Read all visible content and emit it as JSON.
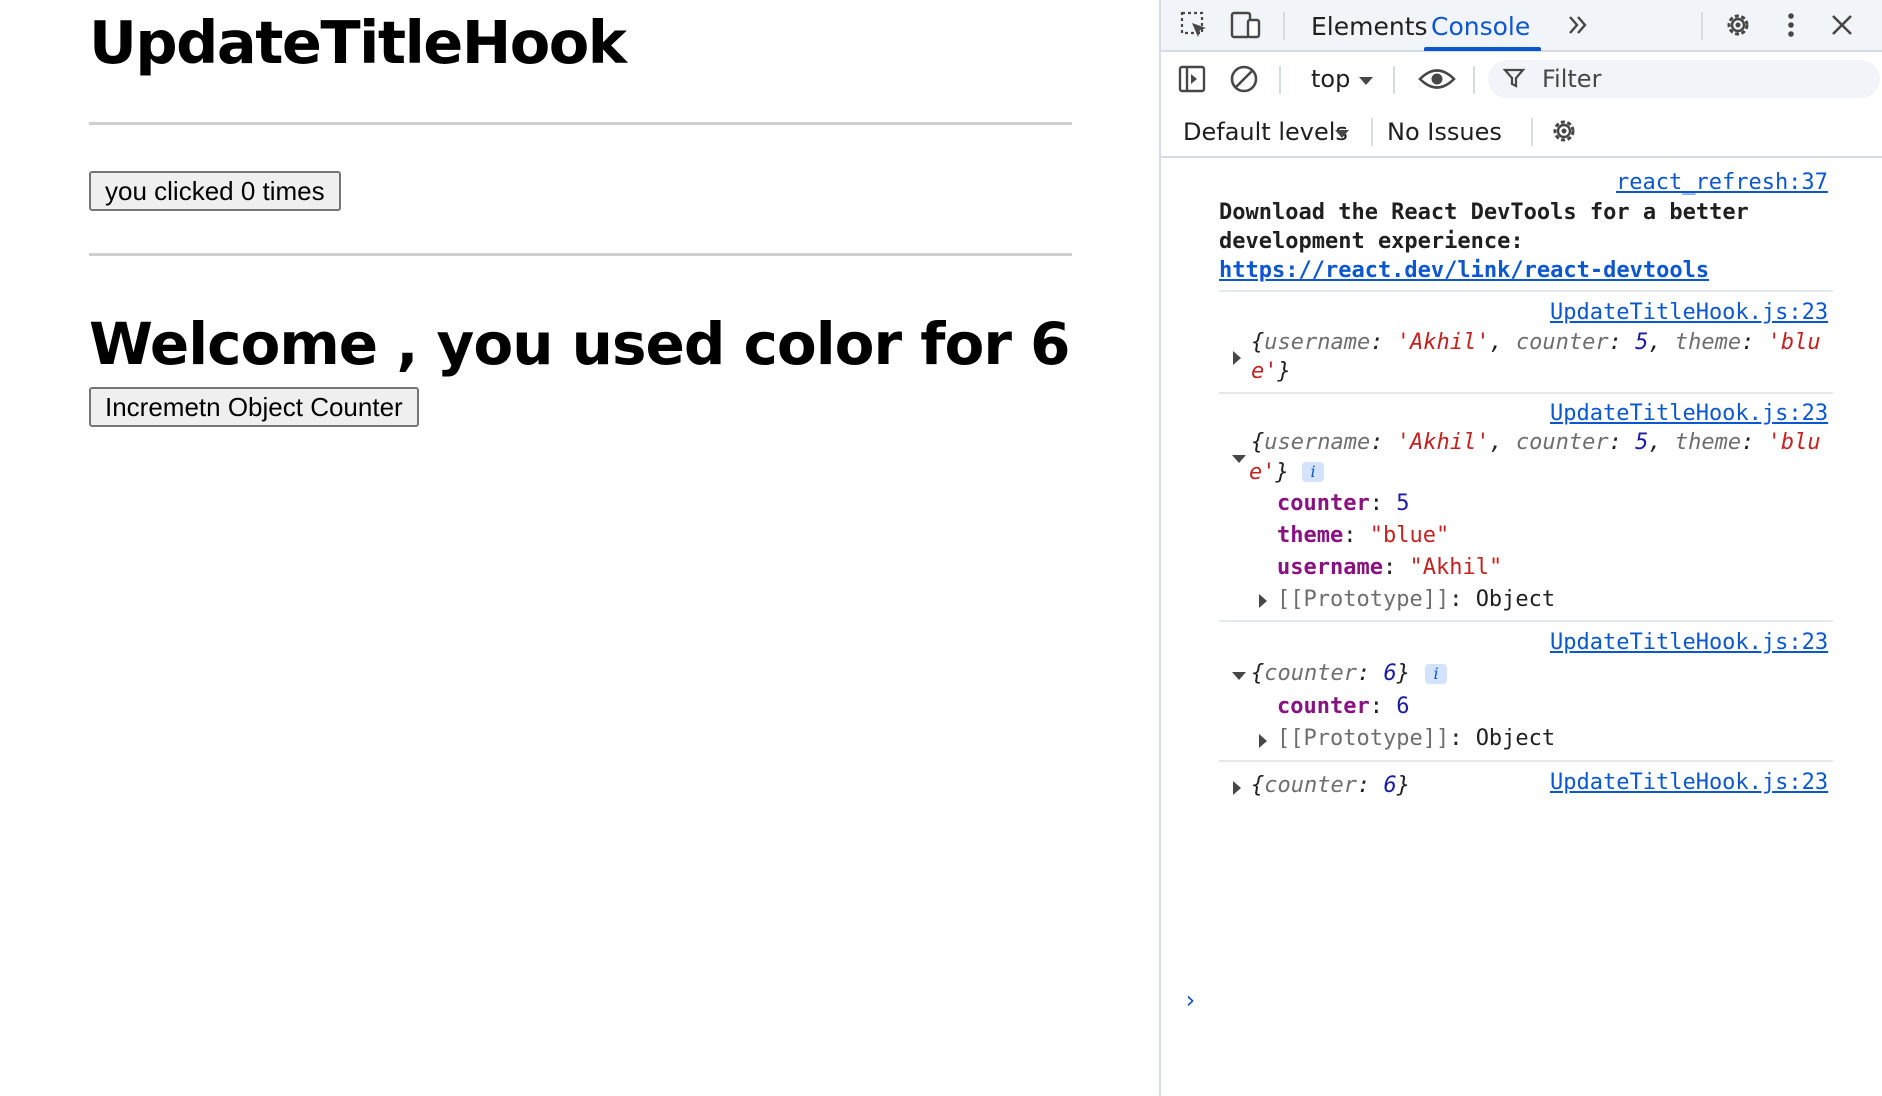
{
  "page": {
    "title": "UpdateTitleHook",
    "click_button_label": "you clicked 0 times",
    "welcome_text": "Welcome , you used color for 6",
    "increment_button_label": "Incremetn Object Counter"
  },
  "devtools": {
    "tabs": [
      {
        "label": "Elements",
        "active": false
      },
      {
        "label": "Console",
        "active": true
      }
    ],
    "more_tabs_icon": "double-chevron-icon",
    "toolbar": {
      "context": "top",
      "filter_placeholder": "Filter",
      "levels": "Default levels",
      "issues": "No Issues"
    },
    "accent_color": "#0b57d0",
    "messages": [
      {
        "source": "react_refresh:37",
        "text_line1": "Download the React DevTools for a better",
        "text_line2": "development experience: ",
        "link": "https://react.dev/link/react-devtools"
      },
      {
        "source": "UpdateTitleHook.js:23",
        "preview_line1": {
          "open": "{",
          "k1": "username",
          "v1": "'Akhil'",
          "k2": "counter",
          "v2": "5",
          "k3": "theme",
          "v3a": "'blu"
        },
        "preview_line2": {
          "v3b": "e'",
          "close": "}"
        },
        "expanded": false
      },
      {
        "source": "UpdateTitleHook.js:23",
        "preview_line1": {
          "open": "{",
          "k1": "username",
          "v1": "'Akhil'",
          "k2": "counter",
          "v2": "5",
          "k3": "theme",
          "v3a": "'blu"
        },
        "preview_line2": {
          "v3b": "e'",
          "close": "}"
        },
        "expanded": true,
        "properties": [
          {
            "key": "counter",
            "value": "5",
            "type": "number"
          },
          {
            "key": "theme",
            "value": "\"blue\"",
            "type": "string"
          },
          {
            "key": "username",
            "value": "\"Akhil\"",
            "type": "string"
          }
        ],
        "prototype_key": "[[Prototype]]",
        "prototype_value": "Object"
      },
      {
        "source": "UpdateTitleHook.js:23",
        "preview": {
          "open": "{",
          "k1": "counter",
          "v1": "6",
          "close": "}"
        },
        "expanded": true,
        "properties": [
          {
            "key": "counter",
            "value": "6",
            "type": "number"
          }
        ],
        "prototype_key": "[[Prototype]]",
        "prototype_value": "Object"
      },
      {
        "source": "UpdateTitleHook.js:23",
        "preview": {
          "open": "{",
          "k1": "counter",
          "v1": "6",
          "close": "}"
        },
        "expanded": false
      }
    ],
    "prompt": "›",
    "info_badge": "i"
  }
}
